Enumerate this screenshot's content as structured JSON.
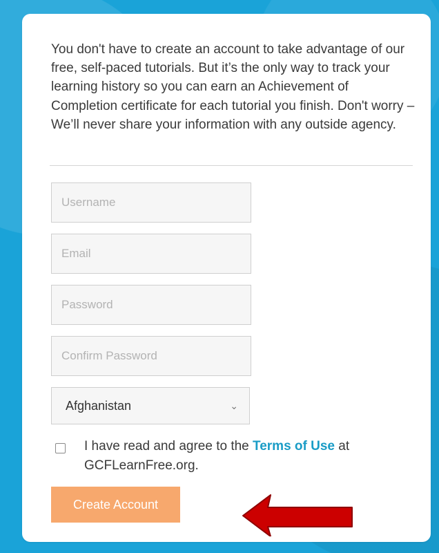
{
  "intro": {
    "text": "You don't have to create an account to take advantage of our free, self-paced tutorials. But it’s the only way to track your learning history so you can earn an Achievement of Completion certificate for each tutorial you finish. Don't worry – We’ll never share your information with any outside agency."
  },
  "form": {
    "username_placeholder": "Username",
    "email_placeholder": "Email",
    "password_placeholder": "Password",
    "confirm_password_placeholder": "Confirm Password",
    "country": {
      "selected": "Afghanistan"
    },
    "terms": {
      "prefix": "I have read and agree to the ",
      "link_text": "Terms of Use",
      "suffix": " at GCFLearnFree.org.",
      "checked": false
    },
    "submit_label": "Create Account"
  },
  "colors": {
    "background": "#1aa3d8",
    "card": "#ffffff",
    "button": "#f7a86d",
    "link": "#1a9cc6",
    "arrow": "#cc0000"
  },
  "icons": {
    "arrow": "red-left-arrow-annotation",
    "select_caret": "chevron-down-icon"
  }
}
